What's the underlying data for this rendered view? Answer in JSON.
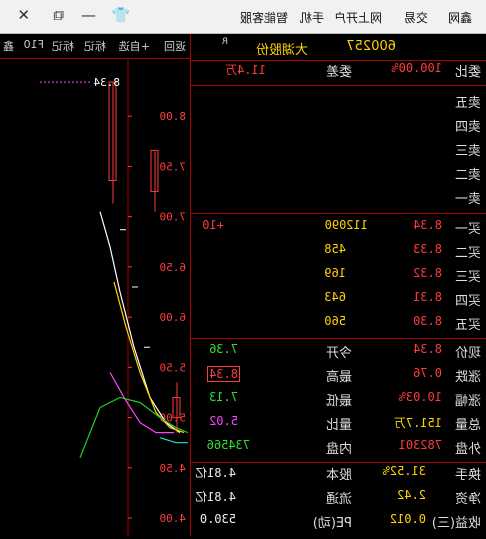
{
  "topbar": {
    "menu": [
      "鑫网",
      "交易",
      "网上开户",
      "手机",
      "智能客服"
    ],
    "controls": [
      "shirt-icon",
      "minimize-icon",
      "restore-icon",
      "close-icon"
    ]
  },
  "stock": {
    "code": "600257",
    "name": "大湖股份",
    "mark": "R"
  },
  "order_ratio": {
    "wei_bi_label": "委比",
    "wei_bi": "100.00%",
    "wei_cha_label": "委差",
    "wei_cha": "11.4万"
  },
  "sell": [
    {
      "label": "卖五"
    },
    {
      "label": "卖四"
    },
    {
      "label": "卖三"
    },
    {
      "label": "卖二"
    },
    {
      "label": "卖一"
    }
  ],
  "buy": [
    {
      "label": "买一",
      "price": "8.34",
      "vol": "112090",
      "chg": "+10"
    },
    {
      "label": "买二",
      "price": "8.33",
      "vol": "458",
      "chg": ""
    },
    {
      "label": "买三",
      "price": "8.32",
      "vol": "169",
      "chg": ""
    },
    {
      "label": "买四",
      "price": "8.31",
      "vol": "643",
      "chg": ""
    },
    {
      "label": "买五",
      "price": "8.30",
      "vol": "560",
      "chg": ""
    }
  ],
  "quote": [
    {
      "l1": "现价",
      "v1": "8.34",
      "l2": "今开",
      "v2": "7.36"
    },
    {
      "l1": "涨跌",
      "v1": "0.76",
      "l2": "最高",
      "v2": "8.34"
    },
    {
      "l1": "涨幅",
      "v1": "10.03%",
      "l2": "最低",
      "v2": "7.13"
    },
    {
      "l1": "总量",
      "v1": "151.7万",
      "l2": "量比",
      "v2": "5.02"
    },
    {
      "l1": "外盘",
      "v1": "782301",
      "l2": "内盘",
      "v2": "734566"
    }
  ],
  "fundamentals": [
    {
      "l1": "换手",
      "v1": "31.52%",
      "l2": "股本",
      "v2": "4.81亿"
    },
    {
      "l1": "净资",
      "v1": "2.42",
      "l2": "流通",
      "v2": "4.81亿"
    },
    {
      "l1": "收益(三)",
      "v1": "0.012",
      "l2": "PE(动)",
      "v2": "530.0"
    }
  ],
  "chart_tabs": [
    "返回",
    "+自选",
    "标记",
    "标记",
    "F10",
    "鑫"
  ],
  "chart_data": {
    "type": "line",
    "y_ticks": [
      "8.00",
      "7.50",
      "7.00",
      "6.50",
      "6.00",
      "5.50",
      "5.00",
      "4.50",
      "4.00"
    ],
    "ylim": [
      4.0,
      8.5
    ],
    "last_price_label": "8.34",
    "colors": {
      "price_up": "#ff3b3b",
      "ma_white": "#ffffff",
      "ma_yellow": "#ffd200",
      "ma_magenta": "#ff44ff",
      "ma_green": "#22cc22",
      "ma_cyan": "#22dddd"
    }
  }
}
